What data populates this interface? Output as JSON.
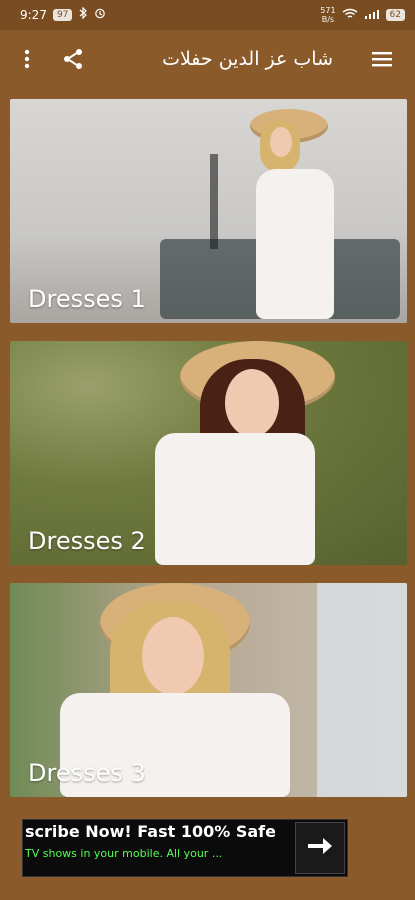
{
  "status_bar": {
    "time": "9:27",
    "badge_text": "97",
    "net_speed_top": "571",
    "net_speed_bottom": "B/s",
    "battery_text": "62",
    "icons": [
      "bluetooth-icon",
      "alarm-icon",
      "signal-icon",
      "wifi-icon",
      "battery-icon"
    ]
  },
  "app_bar": {
    "title": "شاب عز الدين حفلات",
    "icons": [
      "more-vertical-icon",
      "share-icon",
      "menu-icon"
    ]
  },
  "cards": [
    {
      "label": "Dresses 1"
    },
    {
      "label": "Dresses 2"
    },
    {
      "label": "Dresses 3"
    }
  ],
  "ad": {
    "title": "scribe Now! Fast 100% Safe",
    "subtitle": "TV shows in your mobile. All your ..."
  },
  "colors": {
    "background": "#8b5a2b",
    "status_bar": "#7a4c22",
    "ad_text": "#52ff52"
  }
}
